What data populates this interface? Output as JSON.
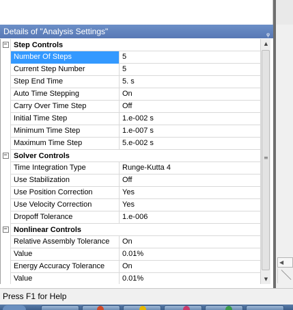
{
  "panel": {
    "title": "Details of \"Analysis Settings\"",
    "pin_icon": "pin-icon"
  },
  "groups": [
    {
      "label": "Step Controls",
      "expander": "−",
      "rows": [
        {
          "name": "Number Of Steps",
          "value": "5",
          "selected": true
        },
        {
          "name": "Current Step Number",
          "value": "5"
        },
        {
          "name": "Step End Time",
          "value": "5. s"
        },
        {
          "name": "Auto Time Stepping",
          "value": "On"
        },
        {
          "name": "Carry Over Time Step",
          "value": "Off"
        },
        {
          "name": "Initial Time Step",
          "value": "1.e-002 s"
        },
        {
          "name": "Minimum Time Step",
          "value": "1.e-007 s"
        },
        {
          "name": "Maximum Time Step",
          "value": "5.e-002 s"
        }
      ]
    },
    {
      "label": "Solver Controls",
      "expander": "−",
      "rows": [
        {
          "name": "Time Integration Type",
          "value": "Runge-Kutta 4"
        },
        {
          "name": "Use Stabilization",
          "value": "Off"
        },
        {
          "name": "Use Position Correction",
          "value": "Yes"
        },
        {
          "name": "Use Velocity Correction",
          "value": "Yes"
        },
        {
          "name": "Dropoff Tolerance",
          "value": "1.e-006"
        }
      ]
    },
    {
      "label": "Nonlinear Controls",
      "expander": "−",
      "rows": [
        {
          "name": "Relative Assembly Tolerance",
          "value": "On"
        },
        {
          "name": "Value",
          "value": "0.01%"
        },
        {
          "name": "Energy Accuracy Tolerance",
          "value": "On"
        },
        {
          "name": "Value",
          "value": "0.01%"
        }
      ]
    }
  ],
  "scrollbar": {
    "up_glyph": "▲",
    "down_glyph": "▼",
    "grip_glyph": "≡"
  },
  "status": {
    "text": "Press F1 for Help"
  },
  "colors": {
    "header": "#5f80bd",
    "selection": "#3399ff"
  }
}
